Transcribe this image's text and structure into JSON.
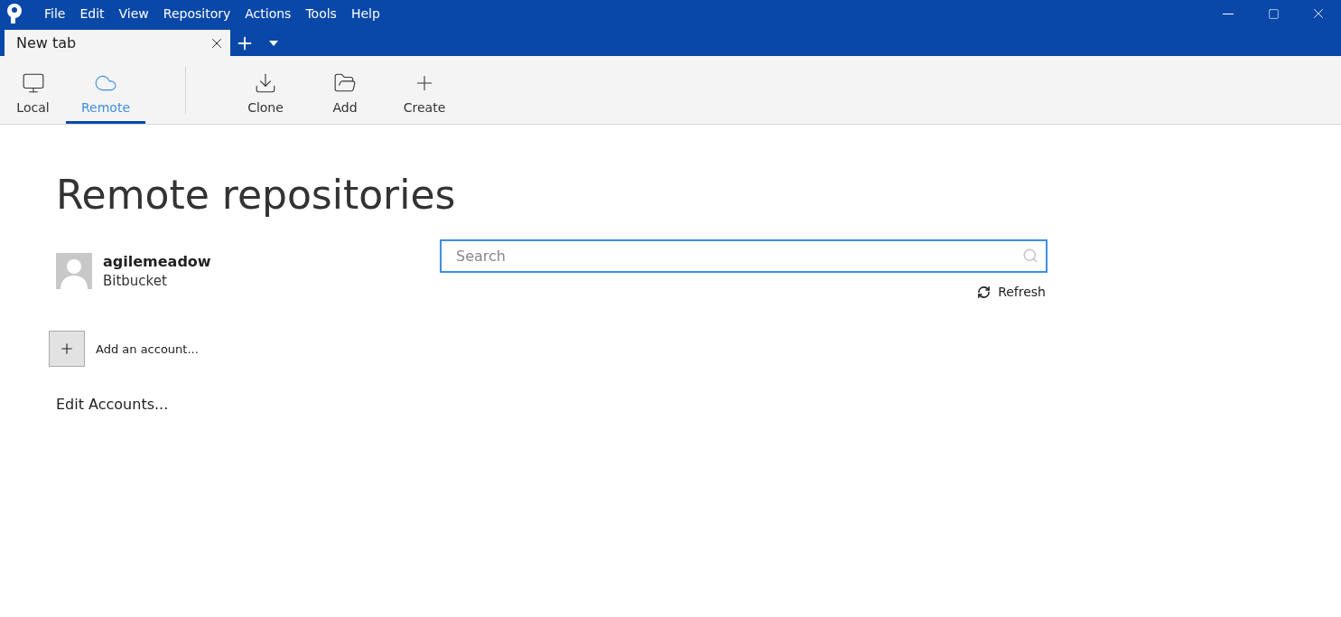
{
  "menu": [
    "File",
    "Edit",
    "View",
    "Repository",
    "Actions",
    "Tools",
    "Help"
  ],
  "tabs": [
    {
      "label": "New tab",
      "selected": true
    }
  ],
  "toolbar": [
    {
      "kind": "view",
      "label": "Local",
      "selected": false
    },
    {
      "kind": "view",
      "label": "Remote",
      "selected": true
    },
    {
      "kind": "action",
      "label": "Clone"
    },
    {
      "kind": "action",
      "label": "Add"
    },
    {
      "kind": "action",
      "label": "Create"
    }
  ],
  "heading": "Remote repositories",
  "accounts": [
    {
      "name": "agilemeadow",
      "service": "Bitbucket"
    }
  ],
  "add_account": "Add an account...",
  "edit_accounts": "Edit Accounts...",
  "search": {
    "placeholder": "Search"
  },
  "refresh": "Refresh"
}
